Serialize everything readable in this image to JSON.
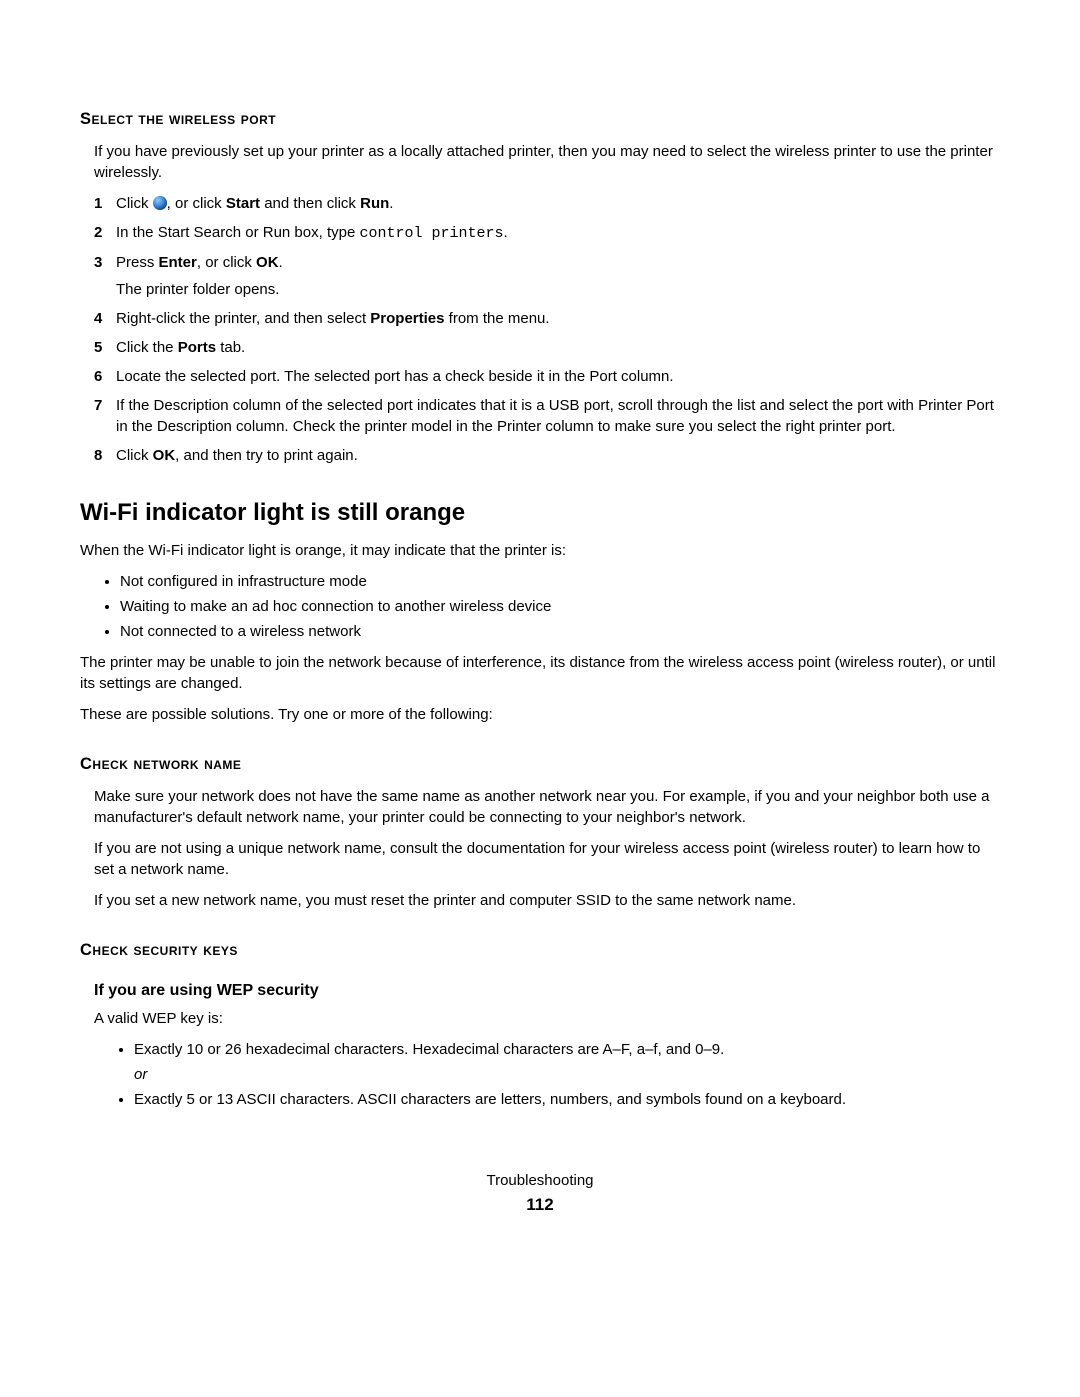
{
  "sec1": {
    "heading": "Select the wireless port",
    "intro": "If you have previously set up your printer as a locally attached printer, then you may need to select the wireless printer to use the printer wirelessly.",
    "steps": {
      "s1_a": "Click ",
      "s1_b": ", or click ",
      "s1_start": "Start",
      "s1_c": " and then click ",
      "s1_run": "Run",
      "s1_d": ".",
      "s2_a": "In the Start Search or Run box, type ",
      "s2_cmd": "control printers",
      "s2_b": ".",
      "s3_a": "Press ",
      "s3_enter": "Enter",
      "s3_b": ", or click ",
      "s3_ok": "OK",
      "s3_c": ".",
      "s3_sub": "The printer folder opens.",
      "s4_a": "Right-click the printer, and then select ",
      "s4_prop": "Properties",
      "s4_b": " from the menu.",
      "s5_a": "Click the ",
      "s5_ports": "Ports",
      "s5_b": " tab.",
      "s6": "Locate the selected port. The selected port has a check beside it in the Port column.",
      "s7": "If the Description column of the selected port indicates that it is a USB port, scroll through the list and select the port with Printer Port in the Description column. Check the printer model in the Printer column to make sure you select the right printer port.",
      "s8_a": "Click ",
      "s8_ok": "OK",
      "s8_b": ", and then try to print again."
    }
  },
  "sec2": {
    "heading": "Wi-Fi indicator light is still orange",
    "p1": "When the Wi-Fi indicator light is orange, it may indicate that the printer is:",
    "bullets": [
      "Not configured in infrastructure mode",
      "Waiting to make an ad hoc connection to another wireless device",
      "Not connected to a wireless network"
    ],
    "p2": "The printer may be unable to join the network because of interference, its distance from the wireless access point (wireless router), or until its settings are changed.",
    "p3": "These are possible solutions. Try one or more of the following:"
  },
  "sec3": {
    "heading": "Check network name",
    "p1": "Make sure your network does not have the same name as another network near you. For example, if you and your neighbor both use a manufacturer's default network name, your printer could be connecting to your neighbor's network.",
    "p2": "If you are not using a unique network name, consult the documentation for your wireless access point (wireless router) to learn how to set a network name.",
    "p3": "If you set a new network name, you must reset the printer and computer SSID to the same network name."
  },
  "sec4": {
    "heading": "Check security keys",
    "sub": "If you are using WEP security",
    "p1": "A valid WEP key is:",
    "b1": "Exactly 10 or 26 hexadecimal characters. Hexadecimal characters are A–F, a–f, and 0–9.",
    "or": "or",
    "b2": "Exactly 5 or 13 ASCII characters. ASCII characters are letters, numbers, and symbols found on a keyboard."
  },
  "footer": {
    "section": "Troubleshooting",
    "page": "112"
  }
}
